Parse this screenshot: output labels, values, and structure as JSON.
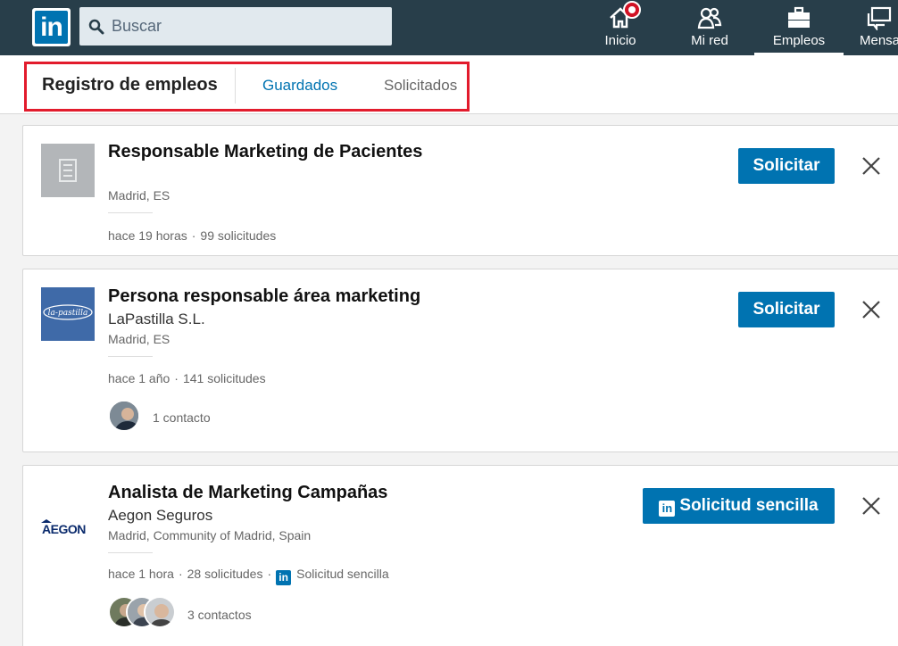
{
  "nav": {
    "logo_text": "in",
    "search_placeholder": "Buscar",
    "items": [
      {
        "label": "Inicio",
        "icon": "home-icon"
      },
      {
        "label": "Mi red",
        "icon": "people-icon"
      },
      {
        "label": "Empleos",
        "icon": "briefcase-icon"
      },
      {
        "label": "Mensa",
        "icon": "messaging-icon"
      }
    ]
  },
  "subnav": {
    "title": "Registro de empleos",
    "tabs": [
      {
        "label": "Guardados"
      },
      {
        "label": "Solicitados"
      }
    ]
  },
  "jobs": [
    {
      "title": "Responsable Marketing de Pacientes",
      "company": "",
      "location": "Madrid, ES",
      "posted": "hace 19 horas",
      "applicants": "99 solicitudes",
      "button": "Solicitar"
    },
    {
      "title": "Persona responsable área marketing",
      "company": "LaPastilla S.L.",
      "location": "Madrid, ES",
      "posted": "hace 1 año",
      "applicants": "141 solicitudes",
      "button": "Solicitar",
      "contacts": "1 contacto",
      "logo_text": "la-pastilla"
    },
    {
      "title": "Analista de Marketing Campañas",
      "company": "Aegon Seguros",
      "location": "Madrid, Community of Madrid, Spain",
      "posted": "hace 1 hora",
      "applicants": "28 solicitudes",
      "easy_apply": "Solicitud sencilla",
      "button": "Solicitud sencilla",
      "contacts": "3 contactos",
      "logo_text": "AEGON"
    }
  ],
  "colors": {
    "nav_bg": "#283e4a",
    "brand_blue": "#0073b1",
    "highlight_red": "#e21b2c"
  }
}
